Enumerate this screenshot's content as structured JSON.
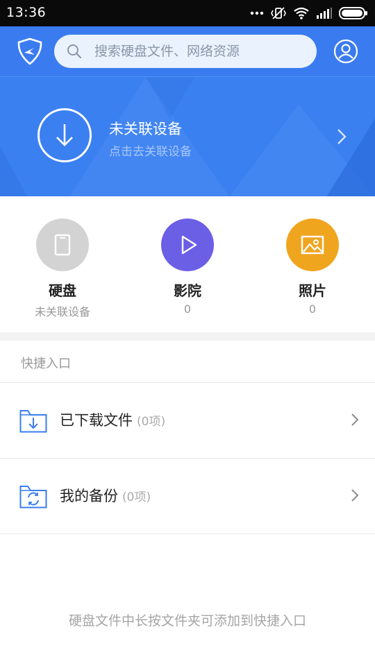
{
  "status_bar": {
    "time": "13:36",
    "icons": [
      "more-dots-icon",
      "vibrate-off-icon",
      "wifi-icon",
      "signal-icon",
      "battery-icon"
    ]
  },
  "header": {
    "logo_icon": "app-logo-icon",
    "search_placeholder": "搜索硬盘文件、网络资源",
    "account_icon": "user-icon",
    "color": "#3a7cf0"
  },
  "banner": {
    "title": "未关联设备",
    "subtitle": "点击去关联设备",
    "icon": "download-arrow-icon",
    "color": "#3b80f1"
  },
  "features": [
    {
      "label": "硬盘",
      "sub": "未关联设备",
      "icon": "phone-icon",
      "color": "#d3d3d3"
    },
    {
      "label": "影院",
      "sub": "0",
      "icon": "play-icon",
      "color": "#6b5fe6"
    },
    {
      "label": "照片",
      "sub": "0",
      "icon": "image-icon",
      "color": "#f0a51f"
    }
  ],
  "quick_access": {
    "title": "快捷入口",
    "items": [
      {
        "label": "已下载文件",
        "count": "(0项)",
        "icon": "download-folder-icon"
      },
      {
        "label": "我的备份",
        "count": "(0项)",
        "icon": "backup-folder-icon"
      }
    ]
  },
  "footer_tip": "硬盘文件中长按文件夹可添加到快捷入口"
}
